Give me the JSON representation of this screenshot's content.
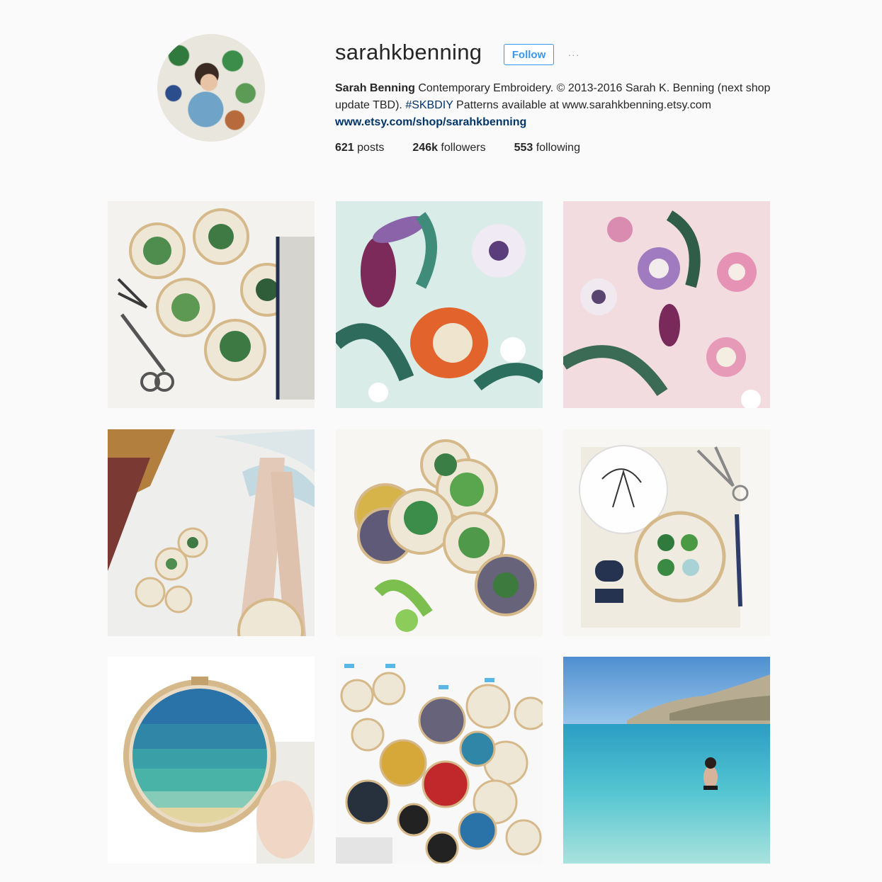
{
  "profile": {
    "username": "sarahkbenning",
    "follow_label": "Follow",
    "more_label": "···",
    "bio": {
      "name": "Sarah Benning",
      "text1": " Contemporary Embroidery. © 2013-2016 Sarah K. Benning (next shop update TBD). ",
      "hashtag": "#SKBDIY",
      "text2": " Patterns available at www.sarahkbenning.etsy.com",
      "link": "www.etsy.com/shop/sarahkbenning"
    },
    "stats": {
      "posts_count": "621",
      "posts_label": " posts",
      "followers_count": "246k",
      "followers_label": " followers",
      "following_count": "553",
      "following_label": " following"
    }
  },
  "colors": {
    "accent": "#3897f0",
    "link": "#003569",
    "background": "#fafafa"
  }
}
